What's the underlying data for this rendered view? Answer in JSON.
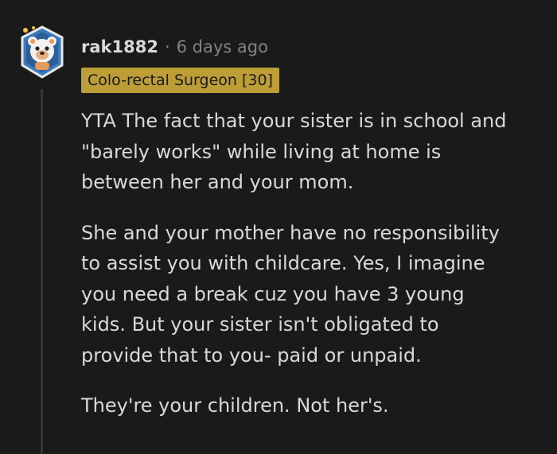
{
  "comment": {
    "username": "rak1882",
    "separator": "·",
    "timestamp": "6 days ago",
    "flair": "Colo-rectal Surgeon [30]",
    "avatar_icon": "snoo-bear-avatar-icon",
    "paragraphs": [
      {
        "lines": [
          "YTA The fact that your sister is in school and",
          "\"barely works\" while living at home is",
          "between her and your mom."
        ]
      },
      {
        "lines": [
          "She and your mother have no responsibility",
          "to assist you with childcare. Yes, I imagine",
          "you need a break cuz you have 3 young",
          "kids. But your sister isn't obligated to",
          "provide that to you- paid or unpaid."
        ]
      },
      {
        "lines": [
          "They're your children. Not her's."
        ]
      }
    ]
  },
  "colors": {
    "background": "#1a1a1b",
    "text": "#d7dadc",
    "muted": "#818384",
    "flair_bg": "#bd9e36",
    "thread_line": "#343536"
  }
}
